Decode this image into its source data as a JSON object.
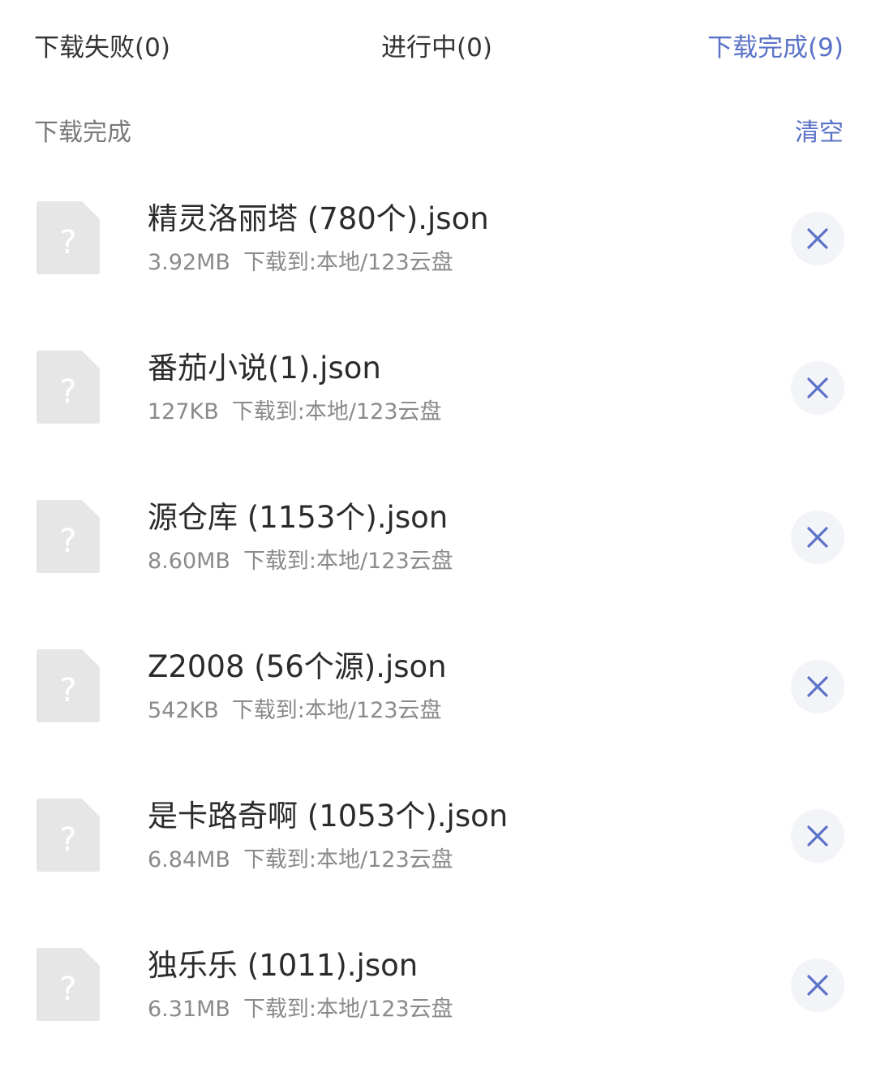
{
  "tabs": {
    "failed": "下载失败(0)",
    "in_progress": "进行中(0)",
    "completed": "下载完成(9)"
  },
  "section": {
    "title": "下载完成",
    "clear_label": "清空"
  },
  "colors": {
    "accent": "#5a72c7",
    "icon_bg": "#e6e6e6"
  },
  "files": [
    {
      "name": "精灵洛丽塔 (780个).json",
      "size": "3.92MB",
      "destination": "下载到:本地/123云盘",
      "icon": "unknown-file-icon"
    },
    {
      "name": "番茄小说(1).json",
      "size": "127KB",
      "destination": "下载到:本地/123云盘",
      "icon": "unknown-file-icon"
    },
    {
      "name": "源仓库 (1153个).json",
      "size": "8.60MB",
      "destination": "下载到:本地/123云盘",
      "icon": "unknown-file-icon"
    },
    {
      "name": "Z2008 (56个源).json",
      "size": "542KB",
      "destination": "下载到:本地/123云盘",
      "icon": "unknown-file-icon"
    },
    {
      "name": "是卡路奇啊 (1053个).json",
      "size": "6.84MB",
      "destination": "下载到:本地/123云盘",
      "icon": "unknown-file-icon"
    },
    {
      "name": "独乐乐 (1011).json",
      "size": "6.31MB",
      "destination": "下载到:本地/123云盘",
      "icon": "unknown-file-icon"
    }
  ]
}
